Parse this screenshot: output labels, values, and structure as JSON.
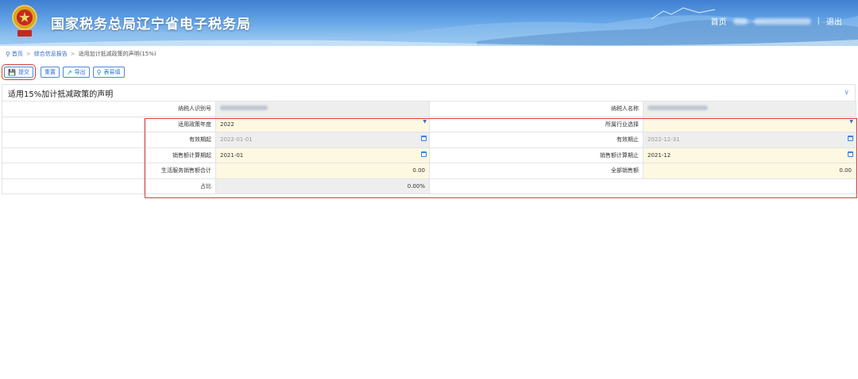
{
  "header": {
    "title": "国家税务总局辽宁省电子税务局",
    "home_link": "首页",
    "logout_link": "退出",
    "colors": {
      "sky_top": "#3f7fd0",
      "sky_bottom": "#a9d2f4",
      "accent": "#2f6fc6",
      "highlight": "#e03b3b"
    }
  },
  "breadcrumb": {
    "home": "首页",
    "section": "综合信息报告",
    "current": "适用加计抵减政策的声明(15%)"
  },
  "toolbar": {
    "submit": "提交",
    "reset": "重置",
    "export": "导出",
    "table_fill": "表易填"
  },
  "panel": {
    "title": "适用15%加计抵减政策的声明"
  },
  "form": {
    "taxpayer_id_label": "纳税人识别号",
    "taxpayer_name_label": "纳税人名称",
    "policy_year_label": "适用政策年度",
    "policy_year_value": "2022",
    "industry_label": "所属行业选择",
    "industry_value": "",
    "valid_from_label": "有效期起",
    "valid_from_value": "2022-01-01",
    "valid_to_label": "有效期止",
    "valid_to_value": "2022-12-31",
    "sales_start_label": "销售额计算期起",
    "sales_start_value": "2021-01",
    "sales_end_label": "销售额计算期止",
    "sales_end_value": "2021-12",
    "life_service_sales_label": "生活服务销售额合计",
    "life_service_sales_value": "0.00",
    "total_sales_label": "全部销售额",
    "total_sales_value": "0.00",
    "ratio_label": "占比",
    "ratio_value": "0.00%"
  }
}
